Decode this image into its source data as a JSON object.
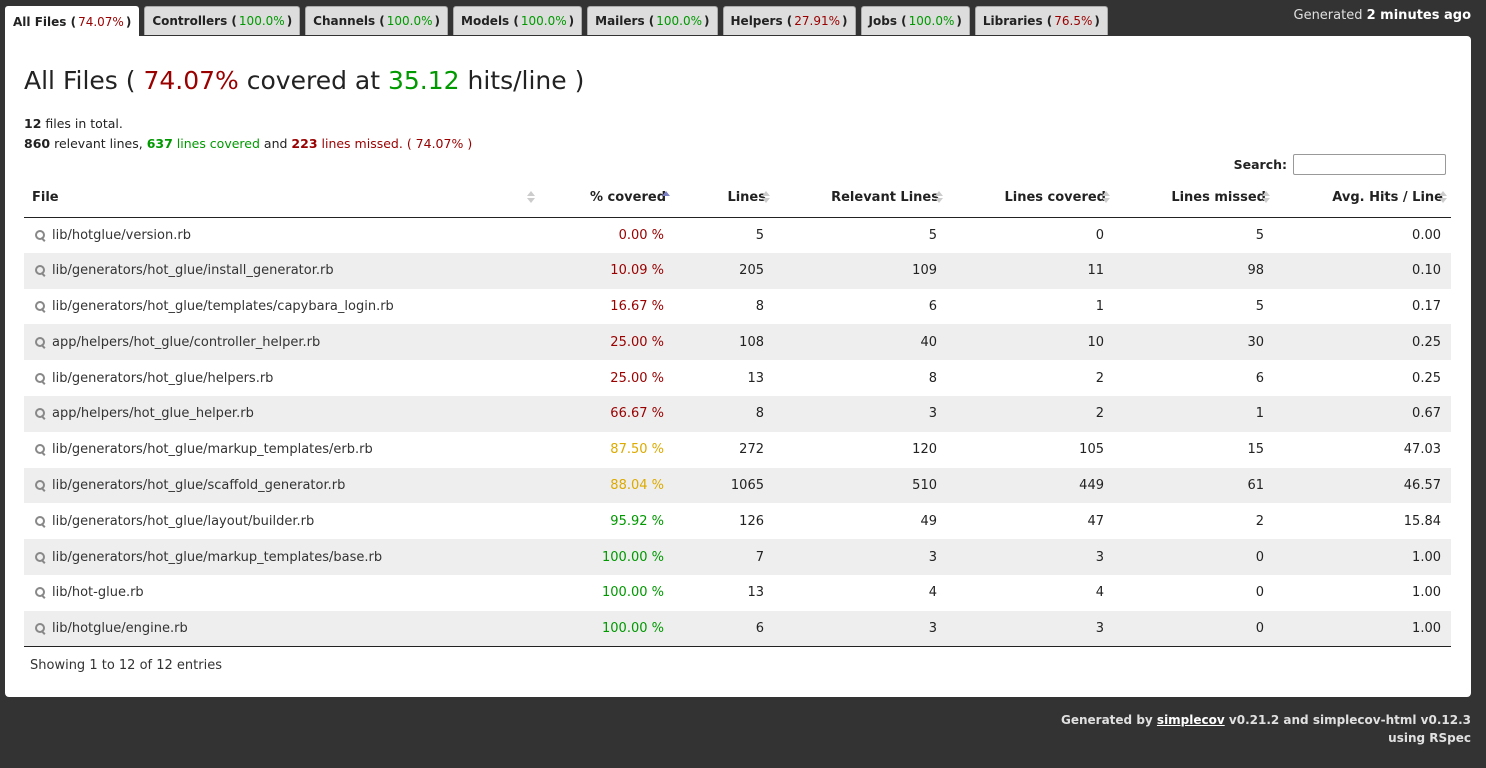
{
  "colors": {
    "red": "#990000",
    "green": "#009900",
    "yellow": "#ddaa00"
  },
  "tabs": [
    {
      "label": "All Files",
      "pct": "74.07%",
      "color": "red",
      "active": true
    },
    {
      "label": "Controllers",
      "pct": "100.0%",
      "color": "green"
    },
    {
      "label": "Channels",
      "pct": "100.0%",
      "color": "green"
    },
    {
      "label": "Models",
      "pct": "100.0%",
      "color": "green"
    },
    {
      "label": "Mailers",
      "pct": "100.0%",
      "color": "green"
    },
    {
      "label": "Helpers",
      "pct": "27.91%",
      "color": "red"
    },
    {
      "label": "Jobs",
      "pct": "100.0%",
      "color": "green"
    },
    {
      "label": "Libraries",
      "pct": "76.5%",
      "color": "red"
    }
  ],
  "generated_top": {
    "prefix": "Generated",
    "when": "2 minutes ago"
  },
  "title": {
    "name": "All Files",
    "covered_pct": "74.07%",
    "covered_word": "covered at",
    "hits": "35.12",
    "hits_unit": "hits/line"
  },
  "summary": {
    "files_count": "12",
    "files_text": "files in total.",
    "relevant": "860",
    "relevant_text": "relevant lines,",
    "covered": "637",
    "covered_text": "lines covered",
    "and_text": "and",
    "missed": "223",
    "missed_text": "lines missed.",
    "pct": "74.07%"
  },
  "search": {
    "label": "Search:",
    "value": ""
  },
  "columns": [
    "File",
    "% covered",
    "Lines",
    "Relevant Lines",
    "Lines covered",
    "Lines missed",
    "Avg. Hits / Line"
  ],
  "rows": [
    {
      "file": "lib/hotglue/version.rb",
      "pct": "0.00 %",
      "color": "red",
      "lines": "5",
      "relevant": "5",
      "covered": "0",
      "missed": "5",
      "avg": "0.00"
    },
    {
      "file": "lib/generators/hot_glue/install_generator.rb",
      "pct": "10.09 %",
      "color": "red",
      "lines": "205",
      "relevant": "109",
      "covered": "11",
      "missed": "98",
      "avg": "0.10"
    },
    {
      "file": "lib/generators/hot_glue/templates/capybara_login.rb",
      "pct": "16.67 %",
      "color": "red",
      "lines": "8",
      "relevant": "6",
      "covered": "1",
      "missed": "5",
      "avg": "0.17"
    },
    {
      "file": "app/helpers/hot_glue/controller_helper.rb",
      "pct": "25.00 %",
      "color": "red",
      "lines": "108",
      "relevant": "40",
      "covered": "10",
      "missed": "30",
      "avg": "0.25"
    },
    {
      "file": "lib/generators/hot_glue/helpers.rb",
      "pct": "25.00 %",
      "color": "red",
      "lines": "13",
      "relevant": "8",
      "covered": "2",
      "missed": "6",
      "avg": "0.25"
    },
    {
      "file": "app/helpers/hot_glue_helper.rb",
      "pct": "66.67 %",
      "color": "red",
      "lines": "8",
      "relevant": "3",
      "covered": "2",
      "missed": "1",
      "avg": "0.67"
    },
    {
      "file": "lib/generators/hot_glue/markup_templates/erb.rb",
      "pct": "87.50 %",
      "color": "yellow",
      "lines": "272",
      "relevant": "120",
      "covered": "105",
      "missed": "15",
      "avg": "47.03"
    },
    {
      "file": "lib/generators/hot_glue/scaffold_generator.rb",
      "pct": "88.04 %",
      "color": "yellow",
      "lines": "1065",
      "relevant": "510",
      "covered": "449",
      "missed": "61",
      "avg": "46.57"
    },
    {
      "file": "lib/generators/hot_glue/layout/builder.rb",
      "pct": "95.92 %",
      "color": "green",
      "lines": "126",
      "relevant": "49",
      "covered": "47",
      "missed": "2",
      "avg": "15.84"
    },
    {
      "file": "lib/generators/hot_glue/markup_templates/base.rb",
      "pct": "100.00 %",
      "color": "green",
      "lines": "7",
      "relevant": "3",
      "covered": "3",
      "missed": "0",
      "avg": "1.00"
    },
    {
      "file": "lib/hot-glue.rb",
      "pct": "100.00 %",
      "color": "green",
      "lines": "13",
      "relevant": "4",
      "covered": "4",
      "missed": "0",
      "avg": "1.00"
    },
    {
      "file": "lib/hotglue/engine.rb",
      "pct": "100.00 %",
      "color": "green",
      "lines": "6",
      "relevant": "3",
      "covered": "3",
      "missed": "0",
      "avg": "1.00"
    }
  ],
  "entries": "Showing 1 to 12 of 12 entries",
  "footer": {
    "prefix": "Generated by",
    "link": "simplecov",
    "rest": "v0.21.2 and simplecov-html v0.12.3",
    "line2": "using RSpec"
  }
}
